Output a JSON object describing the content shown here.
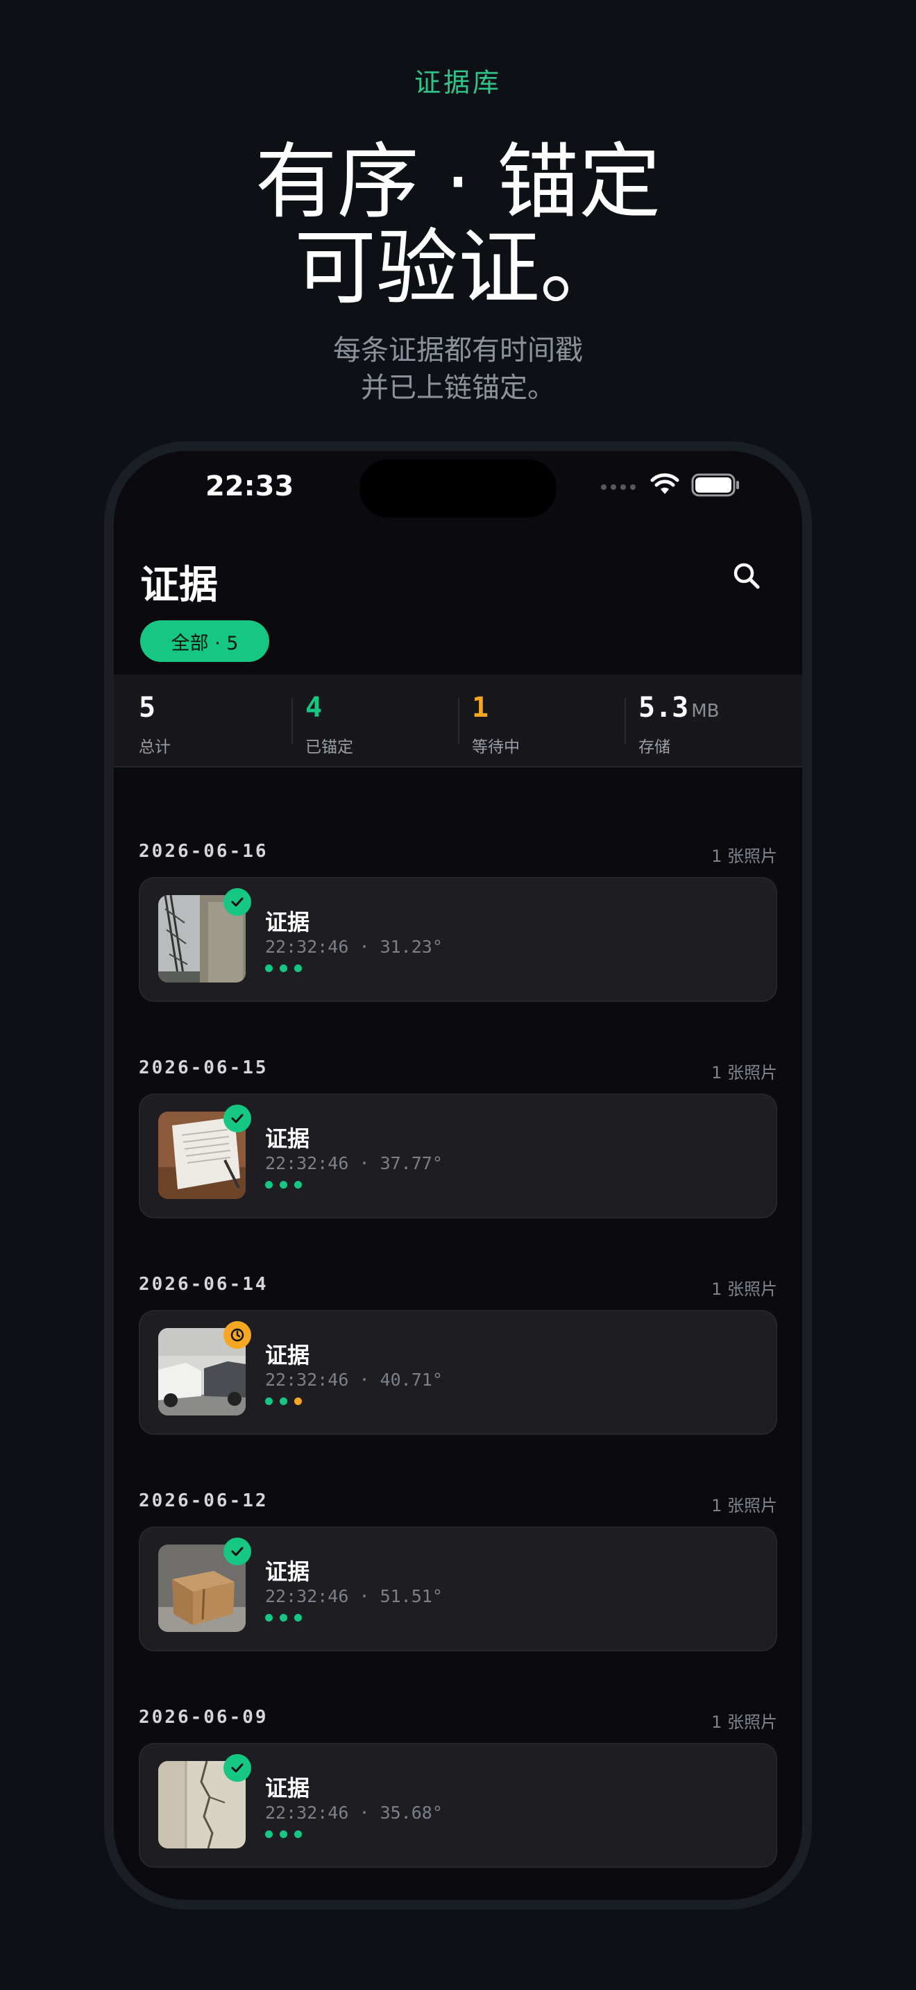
{
  "hero": {
    "eyebrow": "证据库",
    "headline_line1": "有序 · 锚定",
    "headline_line2": "可验证。",
    "sub_line1": "每条证据都有时间戳",
    "sub_line2": "并已上链锚定。"
  },
  "status_bar": {
    "time": "22:33"
  },
  "header": {
    "title": "证据",
    "filter_chip": "全部 · 5",
    "search_icon": "search-icon"
  },
  "stats": [
    {
      "value": "5",
      "unit": "",
      "label": "总计",
      "color": "#ffffff"
    },
    {
      "value": "4",
      "unit": "",
      "label": "已锚定",
      "color": "#16c784"
    },
    {
      "value": "1",
      "unit": "",
      "label": "等待中",
      "color": "#f5a623"
    },
    {
      "value": "5.3",
      "unit": "MB",
      "label": "存储",
      "color": "#ffffff"
    }
  ],
  "sections": [
    {
      "date": "2026-06-16",
      "count": "1 张照片",
      "item": {
        "title": "证据",
        "meta": "22:32:46 · 31.23°",
        "status": "anchored",
        "thumb": "crane"
      }
    },
    {
      "date": "2026-06-15",
      "count": "1 张照片",
      "item": {
        "title": "证据",
        "meta": "22:32:46 · 37.77°",
        "status": "anchored",
        "thumb": "document"
      }
    },
    {
      "date": "2026-06-14",
      "count": "1 张照片",
      "item": {
        "title": "证据",
        "meta": "22:32:46 · 40.71°",
        "status": "pending",
        "thumb": "cars"
      }
    },
    {
      "date": "2026-06-12",
      "count": "1 张照片",
      "item": {
        "title": "证据",
        "meta": "22:32:46 · 51.51°",
        "status": "anchored",
        "thumb": "box"
      }
    },
    {
      "date": "2026-06-09",
      "count": "1 张照片",
      "item": {
        "title": "证据",
        "meta": "22:32:46 · 35.68°",
        "status": "anchored",
        "thumb": "wall-crack"
      }
    }
  ],
  "colors": {
    "accent": "#16c784",
    "pending": "#f5a623",
    "background": "#0d1116"
  }
}
